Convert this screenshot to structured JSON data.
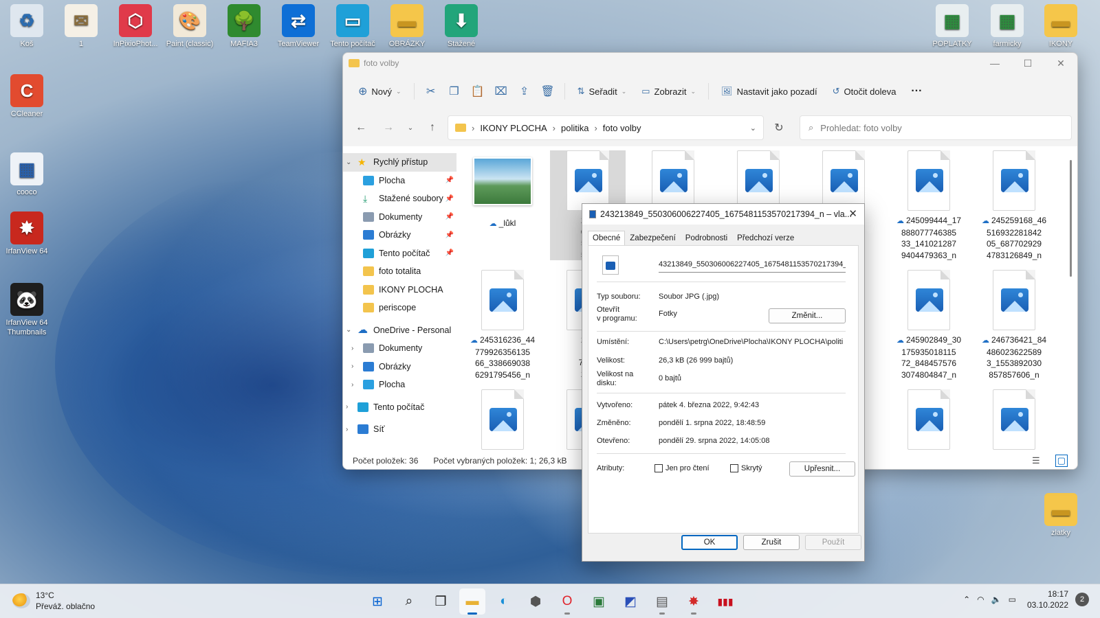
{
  "desktop": {
    "icons_top": [
      {
        "label": "Koš",
        "glyph": "♻",
        "bg": "#dfe7ef",
        "color": "#2b6cb0"
      },
      {
        "label": "1",
        "glyph": "✉",
        "bg": "#f5f0e6",
        "color": "#8a6d3b"
      },
      {
        "label": "InPixioPhot...",
        "glyph": "⬡",
        "bg": "#e03a4a",
        "color": "#ffffff"
      },
      {
        "label": "Paint (classic)",
        "glyph": "🎨",
        "bg": "#f2e9d8",
        "color": "#c24a2a"
      },
      {
        "label": "MAFIA3",
        "glyph": "🌳",
        "bg": "#2f8a2f",
        "color": "#ffffff"
      },
      {
        "label": "TeamViewer",
        "glyph": "⇄",
        "bg": "#0e6fd6",
        "color": "#ffffff"
      },
      {
        "label": "Tento počítač",
        "glyph": "▭",
        "bg": "#1fa0d8",
        "color": "#ffffff"
      },
      {
        "label": "OBRÁZKY",
        "glyph": "▬",
        "bg": "#f5c64a",
        "color": "#c89520"
      },
      {
        "label": "Stažené",
        "glyph": "⬇",
        "bg": "#22a57a",
        "color": "#ffffff"
      }
    ],
    "icons_left": [
      {
        "label": "CCleaner",
        "glyph": "C",
        "bg": "#e24b2f",
        "color": "#ffffff"
      },
      {
        "label": "cooco",
        "glyph": "▦",
        "bg": "#eef2f7",
        "color": "#2a5fa8"
      },
      {
        "label": "IrfanView 64",
        "glyph": "✸",
        "bg": "#c8281e",
        "color": "#ffffff"
      },
      {
        "label": "IrfanView 64 Thumbnails",
        "glyph": "🐼",
        "bg": "#1e1e1e",
        "color": "#ffffff"
      }
    ],
    "icons_right": [
      {
        "label": "POPLATKY",
        "glyph": "▦",
        "bg": "#e8eef0",
        "color": "#2e8a3e"
      },
      {
        "label": "farmicky",
        "glyph": "▦",
        "bg": "#e8eef0",
        "color": "#2e8a3e"
      },
      {
        "label": "IKONY",
        "glyph": "▬",
        "bg": "#f5c64a",
        "color": "#c89520"
      },
      {
        "label": "zlatky",
        "glyph": "▬",
        "bg": "#f5c64a",
        "color": "#c89520"
      }
    ]
  },
  "explorer": {
    "title": "foto volby",
    "toolbar": {
      "new_label": "Nový",
      "sort_label": "Seřadit",
      "view_label": "Zobrazit",
      "set_bg_label": "Nastavit jako pozadí",
      "rotate_label": "Otočit doleva",
      "more_label": "···"
    },
    "breadcrumb": [
      "IKONY PLOCHA",
      "politika",
      "foto volby"
    ],
    "search_placeholder": "Prohledat: foto volby",
    "nav": [
      {
        "label": "Rychlý přístup",
        "level": 0,
        "chev": "⌄",
        "icon": "star",
        "color": "#f5b400",
        "pin": false,
        "selected": true
      },
      {
        "label": "Plocha",
        "level": 1,
        "chev": "",
        "icon": "desktop",
        "color": "#2ba0e0",
        "pin": true
      },
      {
        "label": "Stažené soubory",
        "level": 1,
        "chev": "",
        "icon": "download",
        "color": "#1f9a6e",
        "pin": true
      },
      {
        "label": "Dokumenty",
        "level": 1,
        "chev": "",
        "icon": "docs",
        "color": "#8a9bb0",
        "pin": true
      },
      {
        "label": "Obrázky",
        "level": 1,
        "chev": "",
        "icon": "pictures",
        "color": "#2b7cd3",
        "pin": true
      },
      {
        "label": "Tento počítač",
        "level": 1,
        "chev": "",
        "icon": "computer",
        "color": "#1fa0d8",
        "pin": true
      },
      {
        "label": "foto totalita",
        "level": 1,
        "chev": "",
        "icon": "folder",
        "color": "#f3c44d",
        "pin": false
      },
      {
        "label": "IKONY PLOCHA",
        "level": 1,
        "chev": "",
        "icon": "folder",
        "color": "#f3c44d",
        "pin": false
      },
      {
        "label": "periscope",
        "level": 1,
        "chev": "",
        "icon": "folder",
        "color": "#f3c44d",
        "pin": false
      },
      {
        "label": "OneDrive - Personal",
        "level": 0,
        "chev": "⌄",
        "icon": "cloud",
        "color": "#1f6fc5",
        "pin": false,
        "gap": true
      },
      {
        "label": "Dokumenty",
        "level": 1,
        "chev": "›",
        "icon": "docs",
        "color": "#8a9bb0",
        "pin": false
      },
      {
        "label": "Obrázky",
        "level": 1,
        "chev": "›",
        "icon": "pictures",
        "color": "#2b7cd3",
        "pin": false
      },
      {
        "label": "Plocha",
        "level": 1,
        "chev": "›",
        "icon": "desktop",
        "color": "#2ba0e0",
        "pin": false
      },
      {
        "label": "Tento počítač",
        "level": 0,
        "chev": "›",
        "icon": "computer",
        "color": "#1fa0d8",
        "pin": false,
        "gap": true
      },
      {
        "label": "Síť",
        "level": 0,
        "chev": "›",
        "icon": "network",
        "color": "#2b7cd3",
        "pin": false,
        "gap": true
      }
    ],
    "files": [
      {
        "name": "_lůkl",
        "lines": [
          "_lůkl"
        ],
        "col": 0,
        "row": 0,
        "photo": true
      },
      {
        "name": "243213849",
        "lines": [
          "243",
          "030",
          "5_1",
          "570"
        ],
        "col": 1,
        "row": 0,
        "selected": true
      },
      {
        "name": "file-r0c2",
        "lines": [],
        "col": 2,
        "row": 0
      },
      {
        "name": "file-r0c3",
        "lines": [],
        "col": 3,
        "row": 0
      },
      {
        "name": "file-r0c4",
        "lines": [
          "_43",
          "359",
          "594",
          "3_n"
        ],
        "col": 4,
        "row": 0
      },
      {
        "name": "245099444",
        "lines": [
          "245099444_17",
          "888077746385",
          "33_141021287",
          "9404479363_n"
        ],
        "col": 5,
        "row": 0
      },
      {
        "name": "245259168",
        "lines": [
          "245259168_46",
          "516932281842",
          "05_687702929",
          "4783126849_n"
        ],
        "col": 6,
        "row": 0
      },
      {
        "name": "245316236",
        "lines": [
          "245316236_44",
          "779926356135",
          "66_338669038",
          "6291795456_n"
        ],
        "col": 0,
        "row": 1
      },
      {
        "name": "245-511",
        "lines": [
          "245",
          "511",
          "7_73",
          "278"
        ],
        "col": 1,
        "row": 1
      },
      {
        "name": "file-r1c4",
        "lines": [
          "_31",
          "590",
          "764",
          "3_n"
        ],
        "col": 4,
        "row": 1
      },
      {
        "name": "245902849",
        "lines": [
          "245902849_30",
          "175935018115",
          "72_848457576",
          "3074804847_n"
        ],
        "col": 5,
        "row": 1
      },
      {
        "name": "246736421",
        "lines": [
          "246736421_84",
          "486023622589",
          "3_1553892030",
          "857857606_n"
        ],
        "col": 6,
        "row": 1
      },
      {
        "name": "file-r2c0",
        "lines": [],
        "col": 0,
        "row": 2
      },
      {
        "name": "file-r2c1",
        "lines": [],
        "col": 1,
        "row": 2
      },
      {
        "name": "file-r2c5",
        "lines": [],
        "col": 5,
        "row": 2
      },
      {
        "name": "file-r2c6",
        "lines": [],
        "col": 6,
        "row": 2
      }
    ],
    "status_count": "Počet položek: 36",
    "status_selected": "Počet vybraných položek: 1; 26,3 kB"
  },
  "properties": {
    "title": "243213849_550306006227405_1675481153570217394_n – vla...",
    "tabs": [
      "Obecné",
      "Zabezpečení",
      "Podrobnosti",
      "Předchozí verze"
    ],
    "filename": "43213849_550306006227405_1675481153570217394_n",
    "type_label": "Typ souboru:",
    "type_value": "Soubor JPG (.jpg)",
    "opens_label_1": "Otevřít",
    "opens_label_2": "v programu:",
    "opens_value": "Fotky",
    "change_button": "Změnit...",
    "location_label": "Umístění:",
    "location_value": "C:\\Users\\petrg\\OneDrive\\Plocha\\IKONY PLOCHA\\politi",
    "size_label": "Velikost:",
    "size_value": "26,3 kB (26 999 bajtů)",
    "disk_label_1": "Velikost na",
    "disk_label_2": "disku:",
    "disk_value": "0 bajtů",
    "created_label": "Vytvořeno:",
    "created_value": "pátek 4. března 2022, 9:42:43",
    "modified_label": "Změněno:",
    "modified_value": "pondělí 1. srpna 2022, 18:48:59",
    "accessed_label": "Otevřeno:",
    "accessed_value": "pondělí 29. srpna 2022, 14:05:08",
    "attr_label": "Atributy:",
    "readonly_label": "Jen pro čtení",
    "hidden_label": "Skrytý",
    "advanced_button": "Upřesnit...",
    "ok_button": "OK",
    "cancel_button": "Zrušit",
    "apply_button": "Použít"
  },
  "taskbar": {
    "temp": "13°C",
    "weather": "Převáž. oblačno",
    "apps": [
      {
        "name": "start",
        "glyph": "⊞",
        "color": "#0a64d2"
      },
      {
        "name": "search",
        "glyph": "⌕",
        "color": "#222222"
      },
      {
        "name": "task-view",
        "glyph": "❐",
        "color": "#222222"
      },
      {
        "name": "file-explorer",
        "glyph": "▬",
        "color": "#e8b235",
        "active": true
      },
      {
        "name": "edge",
        "glyph": "◐",
        "color": "#1a8fd8"
      },
      {
        "name": "app-hex",
        "glyph": "⬢",
        "color": "#555555"
      },
      {
        "name": "opera",
        "glyph": "O",
        "color": "#e0242c",
        "running": true
      },
      {
        "name": "monitor-app",
        "glyph": "▣",
        "color": "#2a7a3a"
      },
      {
        "name": "app-chart",
        "glyph": "◩",
        "color": "#2a4fb8"
      },
      {
        "name": "notepad",
        "glyph": "▤",
        "color": "#555555",
        "running": true
      },
      {
        "name": "irfanview",
        "glyph": "✸",
        "color": "#d32a2a",
        "running": true
      },
      {
        "name": "app-bars",
        "glyph": "▮▮▮",
        "color": "#c8101e"
      }
    ],
    "time": "18:17",
    "date": "03.10.2022",
    "notifications": "2"
  }
}
